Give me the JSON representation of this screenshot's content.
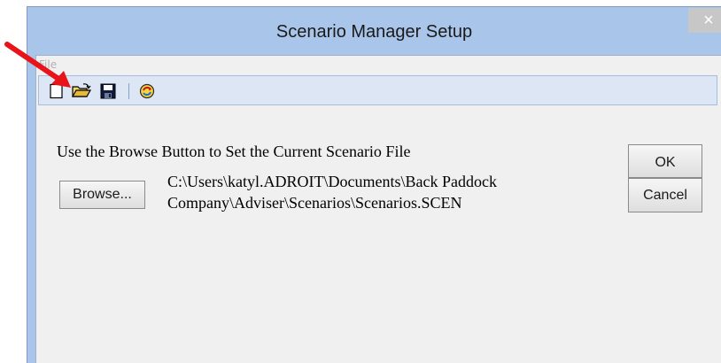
{
  "window": {
    "title": "Scenario Manager Setup",
    "close_glyph": "×"
  },
  "menu": {
    "items": [
      {
        "label": "File"
      }
    ]
  },
  "toolbar": {
    "buttons": [
      {
        "name": "new-file-icon"
      },
      {
        "name": "open-folder-icon"
      },
      {
        "name": "save-disk-icon"
      },
      {
        "name": "refresh-icon"
      }
    ]
  },
  "content": {
    "instruction": "Use the Browse Button to Set the Current Scenario File",
    "browse_label": "Browse...",
    "path_line1": "C:\\Users\\katyl.ADROIT\\Documents\\Back Paddock",
    "path_line2": "Company\\Adviser\\Scenarios\\Scenarios.SCEN",
    "ok_label": "OK",
    "cancel_label": "Cancel"
  },
  "annotation": {
    "arrow_color": "#e8141a",
    "target": "open-folder-icon"
  },
  "colors": {
    "window_frame": "#a9c6ea",
    "toolbar_bg": "#dce6f4",
    "client_bg": "#f0f0f0"
  }
}
